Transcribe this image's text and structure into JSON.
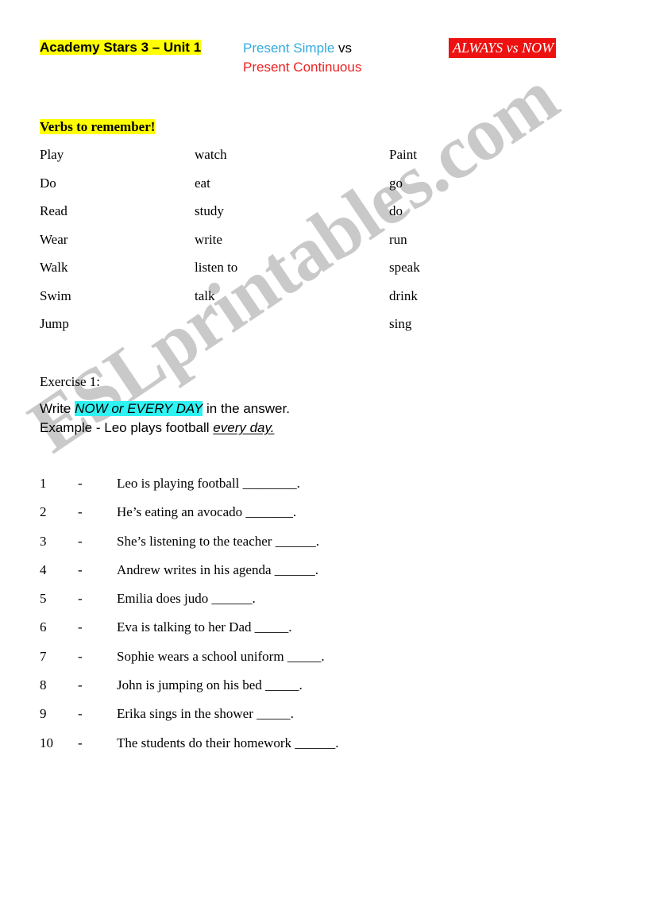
{
  "header": {
    "unit_title": "Academy Stars 3 – Unit 1",
    "center_simple": "Present Simple",
    "center_vs": " vs",
    "center_continuous": "Present Continuous",
    "badge": "ALWAYS vs NOW",
    "highlight_color": "#ffff00",
    "simple_color": "#33aadd",
    "continuous_color": "#ee2222",
    "badge_bg": "#ee1111",
    "badge_color": "#ffffff"
  },
  "verbs": {
    "heading": "Verbs to remember!",
    "heading_highlight": "#ffff00",
    "rows": [
      {
        "col1": "Play",
        "col2": "watch",
        "col3": "Paint"
      },
      {
        "col1": "Do",
        "col2": "eat",
        "col3": "go"
      },
      {
        "col1": "Read",
        "col2": "study",
        "col3": "do"
      },
      {
        "col1": "Wear",
        "col2": "write",
        "col3": "run"
      },
      {
        "col1": "Walk",
        "col2": "listen to",
        "col3": "speak"
      },
      {
        "col1": "Swim",
        "col2": "talk",
        "col3": "drink"
      },
      {
        "col1": "Jump",
        "col2": "",
        "col3": "sing"
      }
    ]
  },
  "exercise": {
    "label": "Exercise 1:",
    "instruction_before": "Write ",
    "instruction_highlight": "NOW or EVERY DAY",
    "instruction_after": " in the answer.",
    "highlight_color": "#2ff2f2",
    "example_prefix": "Example -  Leo plays football ",
    "example_answer": " every day. ",
    "questions": [
      {
        "num": "1",
        "dash": "-",
        "text": "Leo is playing football ________."
      },
      {
        "num": "2",
        "dash": "-",
        "text": "He’s eating an avocado _______."
      },
      {
        "num": "3",
        "dash": "-",
        "text": "She’s listening to the teacher ______."
      },
      {
        "num": "4",
        "dash": "-",
        "text": "Andrew writes in his agenda ______."
      },
      {
        "num": "5",
        "dash": "-",
        "text": "Emilia does judo ______."
      },
      {
        "num": "6",
        "dash": "-",
        "text": "Eva is talking to her Dad _____."
      },
      {
        "num": "7",
        "dash": "-",
        "text": "Sophie wears a school uniform _____."
      },
      {
        "num": "8",
        "dash": "-",
        "text": "John is jumping on his bed _____."
      },
      {
        "num": "9",
        "dash": "-",
        "text": "Erika sings in the shower _____."
      },
      {
        "num": "10",
        "dash": "-",
        "text": "The students do their homework ______."
      }
    ]
  },
  "watermark": {
    "text": "ESLprintables.com",
    "color": "#c9c9c9"
  }
}
